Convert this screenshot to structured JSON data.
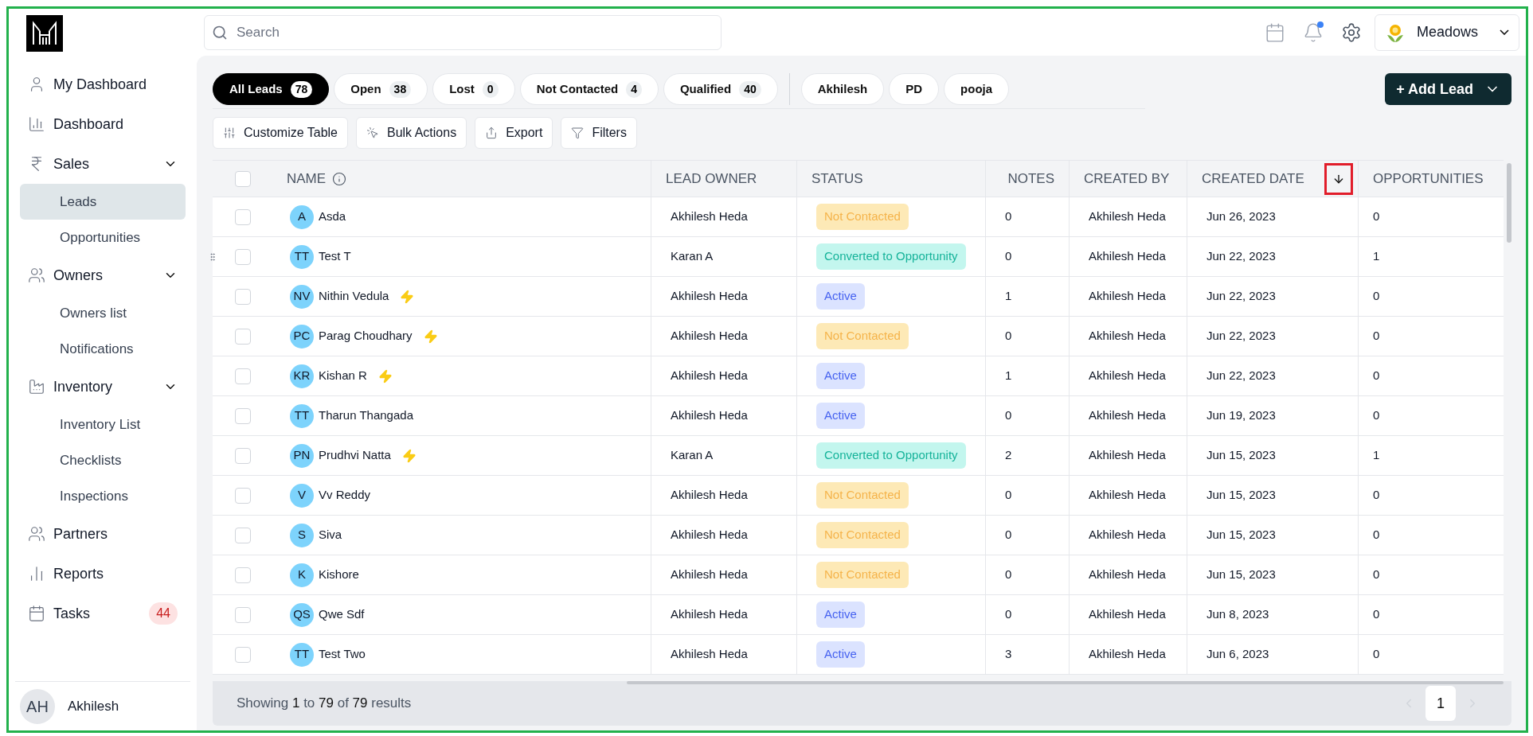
{
  "sidebar": {
    "items": [
      {
        "label": "My Dashboard",
        "selected": false
      },
      {
        "label": "Dashboard",
        "selected": false
      },
      {
        "label": "Sales",
        "expanded": true,
        "children": [
          {
            "label": "Leads",
            "selected": true
          },
          {
            "label": "Opportunities",
            "selected": false
          }
        ]
      },
      {
        "label": "Owners",
        "expanded": true,
        "children": [
          {
            "label": "Owners list",
            "selected": false
          },
          {
            "label": "Notifications",
            "selected": false
          }
        ]
      },
      {
        "label": "Inventory",
        "expanded": true,
        "children": [
          {
            "label": "Inventory List",
            "selected": false
          },
          {
            "label": "Checklists",
            "selected": false
          },
          {
            "label": "Inspections",
            "selected": false
          }
        ]
      },
      {
        "label": "Partners",
        "selected": false
      },
      {
        "label": "Reports",
        "selected": false
      },
      {
        "label": "Tasks",
        "selected": false,
        "badge": "44"
      }
    ],
    "user": {
      "initials": "AH",
      "name": "Akhilesh"
    }
  },
  "search": {
    "placeholder": "Search"
  },
  "header": {
    "notification_dot": true,
    "org": "Meadows"
  },
  "filter_chips": [
    {
      "label": "All Leads",
      "count": "78",
      "selected": true
    },
    {
      "label": "Open",
      "count": "38",
      "selected": false
    },
    {
      "label": "Lost",
      "count": "0",
      "selected": false
    },
    {
      "label": "Not Contacted",
      "count": "4",
      "selected": false
    },
    {
      "label": "Qualified",
      "count": "40",
      "selected": false
    }
  ],
  "saved_chips": [
    {
      "label": "Akhilesh",
      "selected": false
    },
    {
      "label": "PD",
      "selected": false
    },
    {
      "label": "pooja",
      "selected": false
    }
  ],
  "add_button": "+ Add Lead",
  "toolbar": [
    "Customize Table",
    "Bulk Actions",
    "Export",
    "Filters"
  ],
  "table": {
    "select_all": {
      "checked": false
    },
    "columns": [
      {
        "label": "NAME",
        "sorted": false
      },
      {
        "label": "LEAD OWNER",
        "sorted": false
      },
      {
        "label": "STATUS",
        "sorted": false
      },
      {
        "label": "NOTES",
        "sorted": false
      },
      {
        "label": "CREATED BY",
        "sorted": false
      },
      {
        "label": "CREATED DATE",
        "sorted": true
      },
      {
        "label": "OPPORTUNITIES",
        "sorted": false
      }
    ],
    "rows": [
      {
        "checked": false,
        "hovered": false,
        "initials": "A",
        "name": "Asda",
        "hot": false,
        "owner": "Akhilesh Heda",
        "status": {
          "label": "Not Contacted",
          "kind": "not_contacted"
        },
        "notes": "0",
        "created_by": "Akhilesh Heda",
        "created_date": "Jun 26, 2023",
        "opportunities": "0"
      },
      {
        "checked": false,
        "hovered": true,
        "initials": "TT",
        "name": "Test T",
        "hot": false,
        "owner": "Karan A",
        "status": {
          "label": "Converted to Opportunity",
          "kind": "converted"
        },
        "notes": "0",
        "created_by": "Akhilesh Heda",
        "created_date": "Jun 22, 2023",
        "opportunities": "1"
      },
      {
        "checked": false,
        "hovered": false,
        "initials": "NV",
        "name": "Nithin Vedula",
        "hot": true,
        "owner": "Akhilesh Heda",
        "status": {
          "label": "Active",
          "kind": "active"
        },
        "notes": "1",
        "created_by": "Akhilesh Heda",
        "created_date": "Jun 22, 2023",
        "opportunities": "0"
      },
      {
        "checked": false,
        "hovered": false,
        "initials": "PC",
        "name": "Parag Choudhary",
        "hot": true,
        "owner": "Akhilesh Heda",
        "status": {
          "label": "Not Contacted",
          "kind": "not_contacted"
        },
        "notes": "0",
        "created_by": "Akhilesh Heda",
        "created_date": "Jun 22, 2023",
        "opportunities": "0"
      },
      {
        "checked": false,
        "hovered": false,
        "initials": "KR",
        "name": "Kishan R",
        "hot": true,
        "owner": "Akhilesh Heda",
        "status": {
          "label": "Active",
          "kind": "active"
        },
        "notes": "1",
        "created_by": "Akhilesh Heda",
        "created_date": "Jun 22, 2023",
        "opportunities": "0"
      },
      {
        "checked": false,
        "hovered": false,
        "initials": "TT",
        "name": "Tharun Thangada",
        "hot": false,
        "owner": "Akhilesh Heda",
        "status": {
          "label": "Active",
          "kind": "active"
        },
        "notes": "0",
        "created_by": "Akhilesh Heda",
        "created_date": "Jun 19, 2023",
        "opportunities": "0"
      },
      {
        "checked": false,
        "hovered": false,
        "initials": "PN",
        "name": "Prudhvi Natta",
        "hot": true,
        "owner": "Karan A",
        "status": {
          "label": "Converted to Opportunity",
          "kind": "converted"
        },
        "notes": "2",
        "created_by": "Akhilesh Heda",
        "created_date": "Jun 15, 2023",
        "opportunities": "1"
      },
      {
        "checked": false,
        "hovered": false,
        "initials": "V",
        "name": "Vv Reddy",
        "hot": false,
        "owner": "Akhilesh Heda",
        "status": {
          "label": "Not Contacted",
          "kind": "not_contacted"
        },
        "notes": "0",
        "created_by": "Akhilesh Heda",
        "created_date": "Jun 15, 2023",
        "opportunities": "0"
      },
      {
        "checked": false,
        "hovered": false,
        "initials": "S",
        "name": "Siva",
        "hot": false,
        "owner": "Akhilesh Heda",
        "status": {
          "label": "Not Contacted",
          "kind": "not_contacted"
        },
        "notes": "0",
        "created_by": "Akhilesh Heda",
        "created_date": "Jun 15, 2023",
        "opportunities": "0"
      },
      {
        "checked": false,
        "hovered": false,
        "initials": "K",
        "name": "Kishore",
        "hot": false,
        "owner": "Akhilesh Heda",
        "status": {
          "label": "Not Contacted",
          "kind": "not_contacted"
        },
        "notes": "0",
        "created_by": "Akhilesh Heda",
        "created_date": "Jun 15, 2023",
        "opportunities": "0"
      },
      {
        "checked": false,
        "hovered": false,
        "initials": "QS",
        "name": "Qwe Sdf",
        "hot": false,
        "owner": "Akhilesh Heda",
        "status": {
          "label": "Active",
          "kind": "active"
        },
        "notes": "0",
        "created_by": "Akhilesh Heda",
        "created_date": "Jun 8, 2023",
        "opportunities": "0"
      },
      {
        "checked": false,
        "hovered": false,
        "initials": "TT",
        "name": "Test Two",
        "hot": false,
        "owner": "Akhilesh Heda",
        "status": {
          "label": "Active",
          "kind": "active"
        },
        "notes": "3",
        "created_by": "Akhilesh Heda",
        "created_date": "Jun 6, 2023",
        "opportunities": "0"
      }
    ]
  },
  "footer": {
    "summary": "Showing **1** to **79** of **79** results",
    "pages": [
      {
        "label": "1",
        "selected": true
      }
    ]
  }
}
